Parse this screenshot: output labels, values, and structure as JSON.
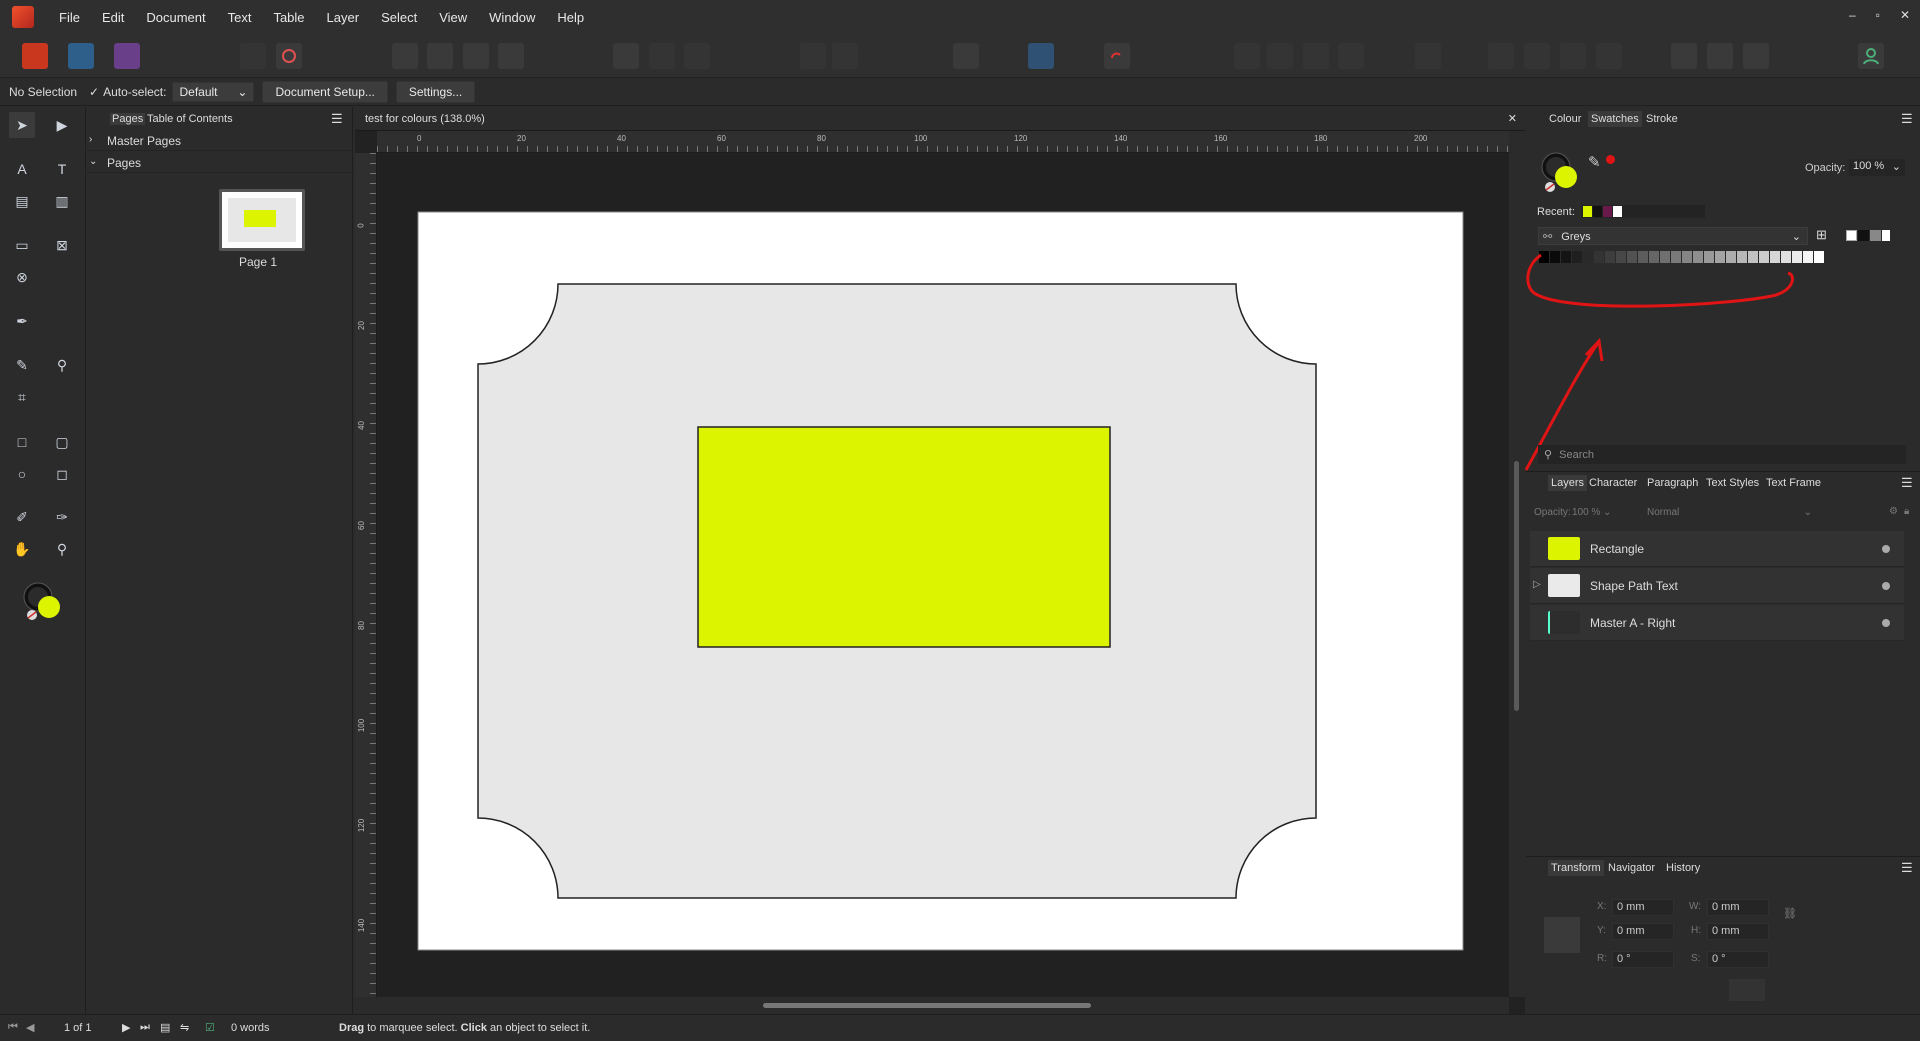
{
  "menubar": {
    "items": [
      "File",
      "Edit",
      "Document",
      "Text",
      "Table",
      "Layer",
      "Select",
      "View",
      "Window",
      "Help"
    ],
    "window_buttons": [
      "–",
      "▫",
      "✕"
    ]
  },
  "context": {
    "selection": "No Selection",
    "autoselect_label": "Auto-select:",
    "autoselect_value": "Default",
    "doc_setup": "Document Setup...",
    "settings": "Settings..."
  },
  "pages_panel": {
    "tabs": [
      "Pages",
      "Table of Contents"
    ],
    "master_pages": "Master Pages",
    "pages": "Pages",
    "page_label": "Page 1"
  },
  "document": {
    "tab_title": "test for colours (138.0%)",
    "h_ruler": [
      "0",
      "20",
      "40",
      "60",
      "80",
      "100",
      "120",
      "140",
      "160",
      "180",
      "200"
    ],
    "v_ruler": [
      "0",
      "20",
      "40",
      "60",
      "80",
      "100",
      "120",
      "140"
    ],
    "rect_color": "#dcf400",
    "frame_color": "#e7e7e7"
  },
  "swatches_panel": {
    "tabs": [
      "Colour",
      "Swatches",
      "Stroke"
    ],
    "opacity_label": "Opacity:",
    "opacity_value": "100 %",
    "recent_label": "Recent:",
    "recent_colors": [
      "#dcf400",
      "#111111",
      "#6a1a4a",
      "#ffffff"
    ],
    "palette": "Greys",
    "annotation_color": "#e01414",
    "search_placeholder": "Search"
  },
  "layers_panel": {
    "tabs": [
      "Layers",
      "Character",
      "Paragraph",
      "Text Styles",
      "Text Frame"
    ],
    "opacity_label": "Opacity:",
    "opacity_value": "100 %",
    "blend_mode": "Normal",
    "layers": [
      {
        "name": "Rectangle",
        "color": "#dcf400"
      },
      {
        "name": "Shape Path Text",
        "color": "#eaeaea"
      },
      {
        "name": "Master A - Right",
        "color": "#2d2d2d"
      }
    ]
  },
  "transform_panel": {
    "tabs": [
      "Transform",
      "Navigator",
      "History"
    ],
    "fields": [
      {
        "label": "X:",
        "value": "0 mm"
      },
      {
        "label": "W:",
        "value": "0 mm"
      },
      {
        "label": "Y:",
        "value": "0 mm"
      },
      {
        "label": "H:",
        "value": "0 mm"
      },
      {
        "label": "R:",
        "value": "0 °"
      },
      {
        "label": "S:",
        "value": "0 °"
      }
    ]
  },
  "statusbar": {
    "page_count": "1 of 1",
    "words": "0 words",
    "hint_bold1": "Drag",
    "hint1": " to marquee select. ",
    "hint_bold2": "Click",
    "hint2": " an object to select it."
  }
}
